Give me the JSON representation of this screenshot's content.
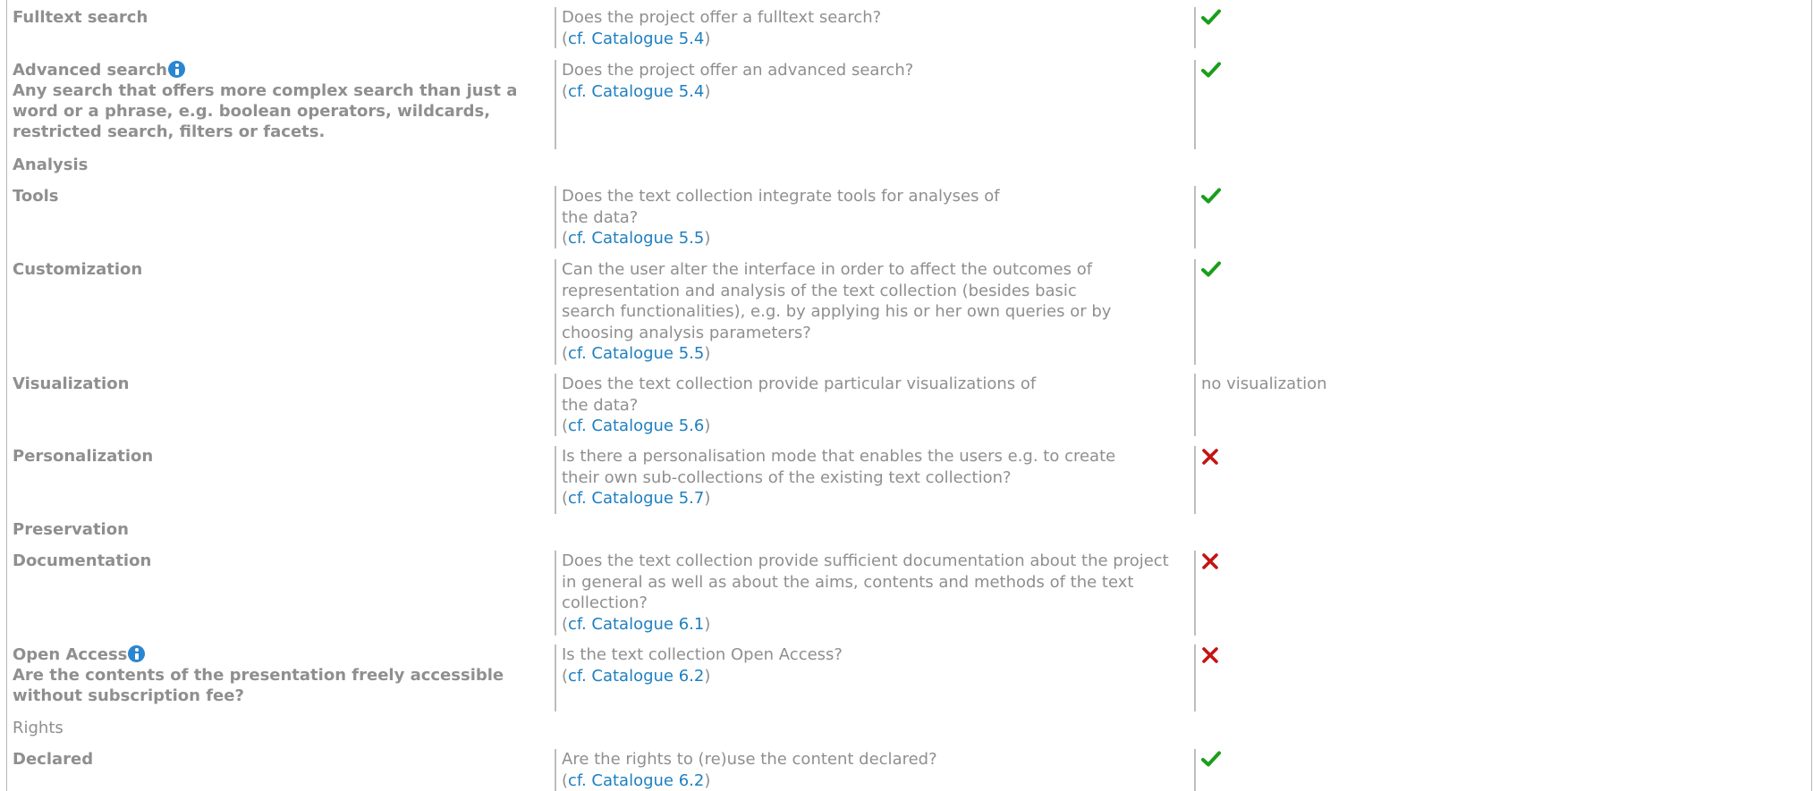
{
  "rows": [
    {
      "label": "Fulltext search",
      "question": "Does the project offer a fulltext search?",
      "ref": "cf. Catalogue 5.4",
      "value_icon": "check-icon"
    },
    {
      "label": "Advanced search",
      "note": "Any search that offers more complex search than just a word or a phrase, e.g. boolean operators, wildcards, restricted search, filters or facets.",
      "question": "Does the project offer an advanced search?",
      "ref": "cf. Catalogue 5.4",
      "value_icon": "check-icon"
    },
    {
      "section": "Analysis"
    },
    {
      "label": "Tools",
      "question": "Does the text collection integrate tools for analyses of the data?",
      "ref": "cf. Catalogue 5.5",
      "value_icon": "check-icon"
    },
    {
      "label": "Customization",
      "question": "Can the user alter the interface in order to affect the outcomes of representation and analysis of the text collection (besides basic search functionalities), e.g. by applying his or her own queries or by choosing analysis parameters?",
      "ref": "cf. Catalogue 5.5",
      "value_icon": "check-icon"
    },
    {
      "label": "Visualization",
      "question": "Does the text collection provide particular visualizations of the data?",
      "ref": "cf. Catalogue 5.6",
      "value_text": "no visualization"
    },
    {
      "label": "Personalization",
      "question": "Is there a personalisation mode that enables the users e.g. to create their own sub-collections of the existing text collection?",
      "ref": "cf. Catalogue 5.7",
      "value_icon": "cross-icon"
    },
    {
      "section": "Preservation"
    },
    {
      "label": "Documentation",
      "question": "Does the text collection provide sufficient documentation about the project in general as well as about the aims, contents and methods of the text collection?",
      "ref": "cf. Catalogue 6.1",
      "value_icon": "cross-icon"
    },
    {
      "label": "Open Access",
      "note": "Are the contents of the presentation freely accessible without subscription fee?",
      "question": "Is the text collection Open Access?",
      "ref": "cf. Catalogue 6.2",
      "value_icon": "cross-icon"
    },
    {
      "section": "Rights"
    },
    {
      "label": "Declared",
      "question": "Are the rights to (re)use the content declared?",
      "ref": "cf. Catalogue 6.2",
      "value_icon": "check-icon"
    }
  ],
  "colors": {
    "check": "#1a9e1a",
    "cross": "#c41414",
    "link": "#1f7fbf",
    "info": "#2a86d0"
  }
}
